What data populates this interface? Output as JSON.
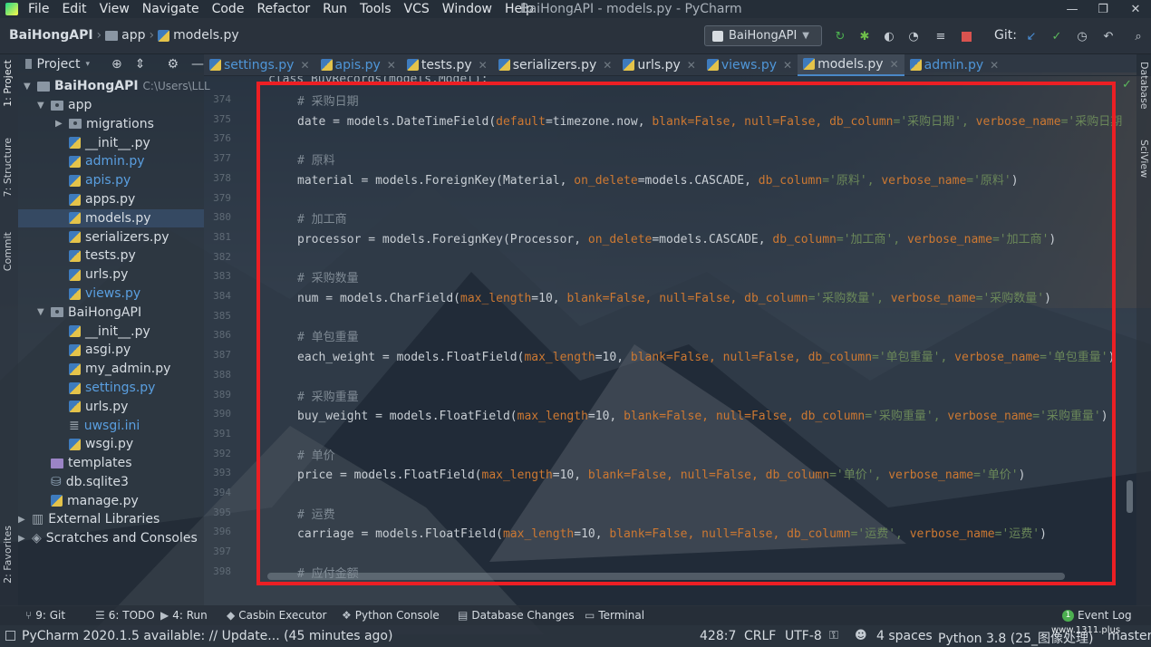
{
  "menubar": {
    "items": [
      "File",
      "Edit",
      "View",
      "Navigate",
      "Code",
      "Refactor",
      "Run",
      "Tools",
      "VCS",
      "Window",
      "Help"
    ],
    "window_title": "BaiHongAPI - models.py - PyCharm"
  },
  "navbar": {
    "breadcrumbs": [
      "BaiHongAPI",
      "app",
      "models.py"
    ],
    "run_config": "BaiHongAPI",
    "git_label": "Git:"
  },
  "tabs": [
    {
      "label": "settings.py",
      "blue": true,
      "active": false
    },
    {
      "label": "apis.py",
      "blue": true,
      "active": false
    },
    {
      "label": "tests.py",
      "blue": false,
      "active": false
    },
    {
      "label": "serializers.py",
      "blue": false,
      "active": false
    },
    {
      "label": "urls.py",
      "blue": false,
      "active": false
    },
    {
      "label": "views.py",
      "blue": true,
      "active": false
    },
    {
      "label": "models.py",
      "blue": false,
      "active": true
    },
    {
      "label": "admin.py",
      "blue": true,
      "active": false
    }
  ],
  "side_tabs": {
    "left": [
      "1: Project",
      "7: Structure",
      "Commit",
      "2: Favorites"
    ],
    "right": [
      "Database",
      "SciView"
    ]
  },
  "project": {
    "header": "Project",
    "root": "BaiHongAPI",
    "root_path": "C:\\Users\\LLL",
    "tree": [
      {
        "label": "app",
        "type": "folder",
        "level": 1,
        "expanded": true,
        "blue": false,
        "selected": false
      },
      {
        "label": "migrations",
        "type": "folder",
        "level": 2,
        "expanded": false,
        "blue": false,
        "selected": false
      },
      {
        "label": "__init__.py",
        "type": "py",
        "level": 2,
        "blue": false,
        "selected": false
      },
      {
        "label": "admin.py",
        "type": "py",
        "level": 2,
        "blue": true,
        "selected": false
      },
      {
        "label": "apis.py",
        "type": "py",
        "level": 2,
        "blue": true,
        "selected": false
      },
      {
        "label": "apps.py",
        "type": "py",
        "level": 2,
        "blue": false,
        "selected": false
      },
      {
        "label": "models.py",
        "type": "py",
        "level": 2,
        "blue": false,
        "selected": true
      },
      {
        "label": "serializers.py",
        "type": "py",
        "level": 2,
        "blue": false,
        "selected": false
      },
      {
        "label": "tests.py",
        "type": "py",
        "level": 2,
        "blue": false,
        "selected": false
      },
      {
        "label": "urls.py",
        "type": "py",
        "level": 2,
        "blue": false,
        "selected": false
      },
      {
        "label": "views.py",
        "type": "py",
        "level": 2,
        "blue": true,
        "selected": false
      },
      {
        "label": "BaiHongAPI",
        "type": "folder",
        "level": 1,
        "expanded": true,
        "blue": false,
        "selected": false
      },
      {
        "label": "__init__.py",
        "type": "py",
        "level": 2,
        "blue": false,
        "selected": false
      },
      {
        "label": "asgi.py",
        "type": "py",
        "level": 2,
        "blue": false,
        "selected": false
      },
      {
        "label": "my_admin.py",
        "type": "py",
        "level": 2,
        "blue": false,
        "selected": false
      },
      {
        "label": "settings.py",
        "type": "py",
        "level": 2,
        "blue": true,
        "selected": false
      },
      {
        "label": "urls.py",
        "type": "py",
        "level": 2,
        "blue": false,
        "selected": false
      },
      {
        "label": "uwsgi.ini",
        "type": "ini",
        "level": 2,
        "blue": true,
        "selected": false
      },
      {
        "label": "wsgi.py",
        "type": "py",
        "level": 2,
        "blue": false,
        "selected": false
      },
      {
        "label": "templates",
        "type": "purple",
        "level": 1,
        "blue": false,
        "selected": false
      },
      {
        "label": "db.sqlite3",
        "type": "db",
        "level": 1,
        "blue": false,
        "selected": false
      },
      {
        "label": "manage.py",
        "type": "py",
        "level": 1,
        "blue": false,
        "selected": false
      }
    ],
    "external": "External Libraries",
    "scratches": "Scratches and Consoles"
  },
  "editor": {
    "partial_first_line": "class BuyRecords(models.Model):",
    "line_numbers": [
      "374",
      "375",
      "376",
      "377",
      "378",
      "379",
      "380",
      "381",
      "382",
      "383",
      "384",
      "385",
      "386",
      "387",
      "388",
      "389",
      "390",
      "391",
      "392",
      "393",
      "394",
      "395",
      "396",
      "397",
      "398"
    ],
    "lines": [
      {
        "num": "374",
        "parts": [
          {
            "t": "# 采购日期",
            "c": "cmt"
          }
        ]
      },
      {
        "num": "375",
        "parts": [
          {
            "t": "date = models.DateTimeField(",
            "c": "fn"
          },
          {
            "t": "default",
            "c": "kw"
          },
          {
            "t": "=timezone.now, ",
            "c": "fn"
          },
          {
            "t": "blank",
            "c": "kw"
          },
          {
            "t": "=False, ",
            "c": "kw2"
          },
          {
            "t": "null",
            "c": "kw"
          },
          {
            "t": "=False, ",
            "c": "kw2"
          },
          {
            "t": "db_column",
            "c": "kw"
          },
          {
            "t": "='采购日期', ",
            "c": "str"
          },
          {
            "t": "verbose_name",
            "c": "kw"
          },
          {
            "t": "='采购日期",
            "c": "str"
          }
        ]
      },
      {
        "num": "376",
        "parts": []
      },
      {
        "num": "377",
        "parts": [
          {
            "t": "# 原料",
            "c": "cmt"
          }
        ]
      },
      {
        "num": "378",
        "parts": [
          {
            "t": "material = models.ForeignKey(Material, ",
            "c": "fn"
          },
          {
            "t": "on_delete",
            "c": "kw"
          },
          {
            "t": "=models.CASCADE, ",
            "c": "fn"
          },
          {
            "t": "db_column",
            "c": "kw"
          },
          {
            "t": "='原料', ",
            "c": "str"
          },
          {
            "t": "verbose_name",
            "c": "kw"
          },
          {
            "t": "='原料'",
            "c": "str"
          },
          {
            "t": ")",
            "c": "fn"
          }
        ]
      },
      {
        "num": "379",
        "parts": []
      },
      {
        "num": "380",
        "parts": [
          {
            "t": "# 加工商",
            "c": "cmt"
          }
        ]
      },
      {
        "num": "381",
        "parts": [
          {
            "t": "processor = models.ForeignKey(Processor, ",
            "c": "fn"
          },
          {
            "t": "on_delete",
            "c": "kw"
          },
          {
            "t": "=models.CASCADE, ",
            "c": "fn"
          },
          {
            "t": "db_column",
            "c": "kw"
          },
          {
            "t": "='加工商', ",
            "c": "str"
          },
          {
            "t": "verbose_name",
            "c": "kw"
          },
          {
            "t": "='加工商'",
            "c": "str"
          },
          {
            "t": ")",
            "c": "fn"
          }
        ]
      },
      {
        "num": "382",
        "parts": []
      },
      {
        "num": "383",
        "parts": [
          {
            "t": "# 采购数量",
            "c": "cmt"
          }
        ]
      },
      {
        "num": "384",
        "parts": [
          {
            "t": "num = models.CharField(",
            "c": "fn"
          },
          {
            "t": "max_length",
            "c": "kw"
          },
          {
            "t": "=10, ",
            "c": "fn"
          },
          {
            "t": "blank",
            "c": "kw"
          },
          {
            "t": "=False, ",
            "c": "kw2"
          },
          {
            "t": "null",
            "c": "kw"
          },
          {
            "t": "=False, ",
            "c": "kw2"
          },
          {
            "t": "db_column",
            "c": "kw"
          },
          {
            "t": "='采购数量', ",
            "c": "str"
          },
          {
            "t": "verbose_name",
            "c": "kw"
          },
          {
            "t": "='采购数量'",
            "c": "str"
          },
          {
            "t": ")",
            "c": "fn"
          }
        ]
      },
      {
        "num": "385",
        "parts": []
      },
      {
        "num": "386",
        "parts": [
          {
            "t": "# 单包重量",
            "c": "cmt"
          }
        ]
      },
      {
        "num": "387",
        "parts": [
          {
            "t": "each_weight = models.FloatField(",
            "c": "fn"
          },
          {
            "t": "max_length",
            "c": "kw"
          },
          {
            "t": "=10, ",
            "c": "fn"
          },
          {
            "t": "blank",
            "c": "kw"
          },
          {
            "t": "=False, ",
            "c": "kw2"
          },
          {
            "t": "null",
            "c": "kw"
          },
          {
            "t": "=False, ",
            "c": "kw2"
          },
          {
            "t": "db_column",
            "c": "kw"
          },
          {
            "t": "='单包重量', ",
            "c": "str"
          },
          {
            "t": "verbose_name",
            "c": "kw"
          },
          {
            "t": "='单包重量'",
            "c": "str"
          },
          {
            "t": ")",
            "c": "fn"
          }
        ]
      },
      {
        "num": "388",
        "parts": []
      },
      {
        "num": "389",
        "parts": [
          {
            "t": "# 采购重量",
            "c": "cmt"
          }
        ]
      },
      {
        "num": "390",
        "parts": [
          {
            "t": "buy_weight = models.FloatField(",
            "c": "fn"
          },
          {
            "t": "max_length",
            "c": "kw"
          },
          {
            "t": "=10, ",
            "c": "fn"
          },
          {
            "t": "blank",
            "c": "kw"
          },
          {
            "t": "=False, ",
            "c": "kw2"
          },
          {
            "t": "null",
            "c": "kw"
          },
          {
            "t": "=False, ",
            "c": "kw2"
          },
          {
            "t": "db_column",
            "c": "kw"
          },
          {
            "t": "='采购重量', ",
            "c": "str"
          },
          {
            "t": "verbose_name",
            "c": "kw"
          },
          {
            "t": "='采购重量'",
            "c": "str"
          },
          {
            "t": ")",
            "c": "fn"
          }
        ]
      },
      {
        "num": "391",
        "parts": []
      },
      {
        "num": "392",
        "parts": [
          {
            "t": "# 单价",
            "c": "cmt"
          }
        ]
      },
      {
        "num": "393",
        "parts": [
          {
            "t": "price = models.FloatField(",
            "c": "fn"
          },
          {
            "t": "max_length",
            "c": "kw"
          },
          {
            "t": "=10, ",
            "c": "fn"
          },
          {
            "t": "blank",
            "c": "kw"
          },
          {
            "t": "=False, ",
            "c": "kw2"
          },
          {
            "t": "null",
            "c": "kw"
          },
          {
            "t": "=False, ",
            "c": "kw2"
          },
          {
            "t": "db_column",
            "c": "kw"
          },
          {
            "t": "='单价', ",
            "c": "str"
          },
          {
            "t": "verbose_name",
            "c": "kw"
          },
          {
            "t": "='单价'",
            "c": "str"
          },
          {
            "t": ")",
            "c": "fn"
          }
        ]
      },
      {
        "num": "394",
        "parts": []
      },
      {
        "num": "395",
        "parts": [
          {
            "t": "# 运费",
            "c": "cmt"
          }
        ]
      },
      {
        "num": "396",
        "parts": [
          {
            "t": "carriage = models.FloatField(",
            "c": "fn"
          },
          {
            "t": "max_length",
            "c": "kw"
          },
          {
            "t": "=10, ",
            "c": "fn"
          },
          {
            "t": "blank",
            "c": "kw"
          },
          {
            "t": "=False, ",
            "c": "kw2"
          },
          {
            "t": "null",
            "c": "kw"
          },
          {
            "t": "=False, ",
            "c": "kw2"
          },
          {
            "t": "db_column",
            "c": "kw"
          },
          {
            "t": "='运费', ",
            "c": "str"
          },
          {
            "t": "verbose_name",
            "c": "kw"
          },
          {
            "t": "='运费'",
            "c": "str"
          },
          {
            "t": ")",
            "c": "fn"
          }
        ]
      },
      {
        "num": "397",
        "parts": []
      },
      {
        "num": "398",
        "parts": [
          {
            "t": "# 应付金额",
            "c": "cmt"
          }
        ]
      }
    ]
  },
  "bottom_tools": [
    {
      "icon": "git-icon",
      "label": "9: Git"
    },
    {
      "icon": "todo-icon",
      "label": "6: TODO"
    },
    {
      "icon": "run-icon",
      "label": "4: Run"
    },
    {
      "icon": "casbin-icon",
      "label": "Casbin Executor"
    },
    {
      "icon": "python-console-icon",
      "label": "Python Console"
    },
    {
      "icon": "database-changes-icon",
      "label": "Database Changes"
    },
    {
      "icon": "terminal-icon",
      "label": "Terminal"
    }
  ],
  "event_log": {
    "label": "Event Log",
    "count": "1"
  },
  "status": {
    "message": "PyCharm 2020.1.5 available: // Update... (45 minutes ago)",
    "position": "428:7",
    "line_sep": "CRLF",
    "encoding": "UTF-8",
    "indent": "4 spaces",
    "interpreter": "Python 3.8 (25_图像处理)",
    "branch": "master",
    "watermark": "www.1311.plus"
  },
  "colors": {
    "accent_red": "#ec1f24",
    "keyword": "#cc7832",
    "string": "#6a8759",
    "comment": "#7f8a94",
    "link_blue": "#5a9fe0"
  }
}
